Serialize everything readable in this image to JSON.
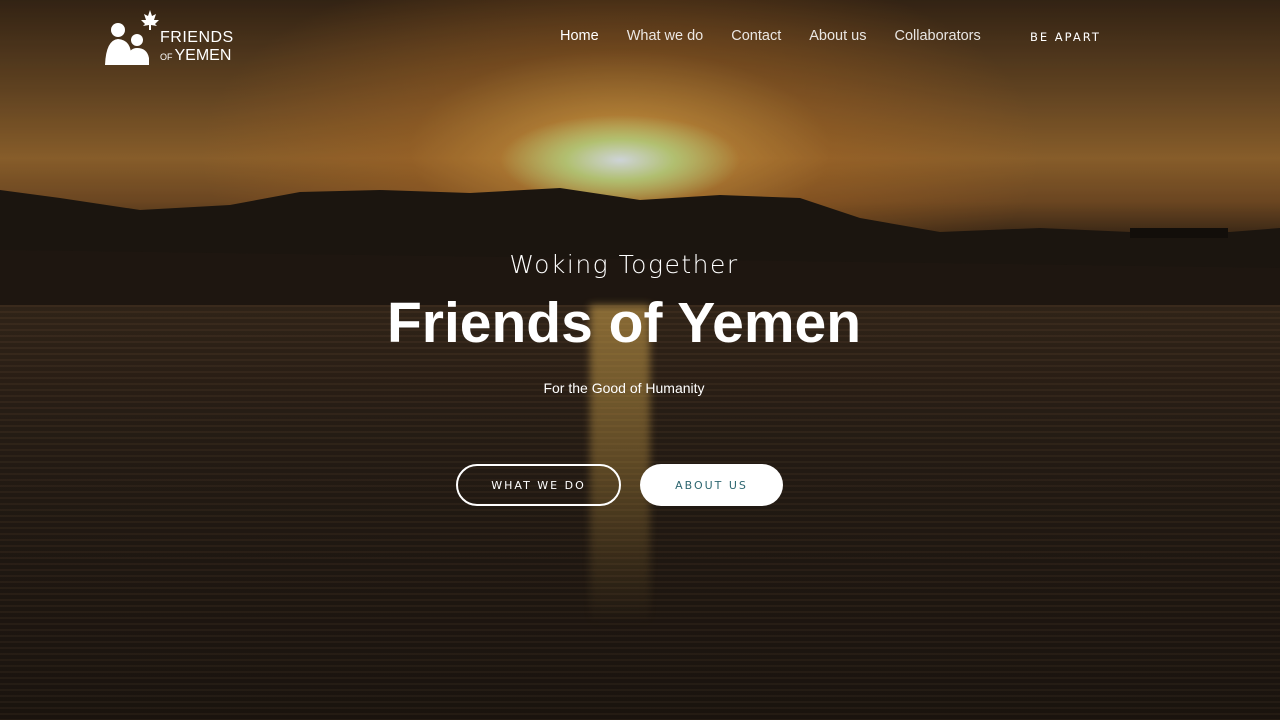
{
  "brand": {
    "logo_line1": "FRIENDS",
    "logo_of": "OF",
    "logo_line2": "YEMEN"
  },
  "nav": {
    "items": [
      {
        "label": "Home",
        "active": true
      },
      {
        "label": "What we do"
      },
      {
        "label": "Contact"
      },
      {
        "label": "About us"
      },
      {
        "label": "Collaborators"
      }
    ],
    "cta_label": "BE APART"
  },
  "hero": {
    "subtitle": "Woking Together",
    "title": "Friends of Yemen",
    "tagline": "For the Good of Humanity",
    "primary_button": "WHAT WE DO",
    "secondary_button": "ABOUT US"
  },
  "colors": {
    "accent": "#2d6670",
    "text": "#ffffff"
  },
  "icons": {
    "logo_mark": "family-silhouette-with-maple-leaf"
  }
}
